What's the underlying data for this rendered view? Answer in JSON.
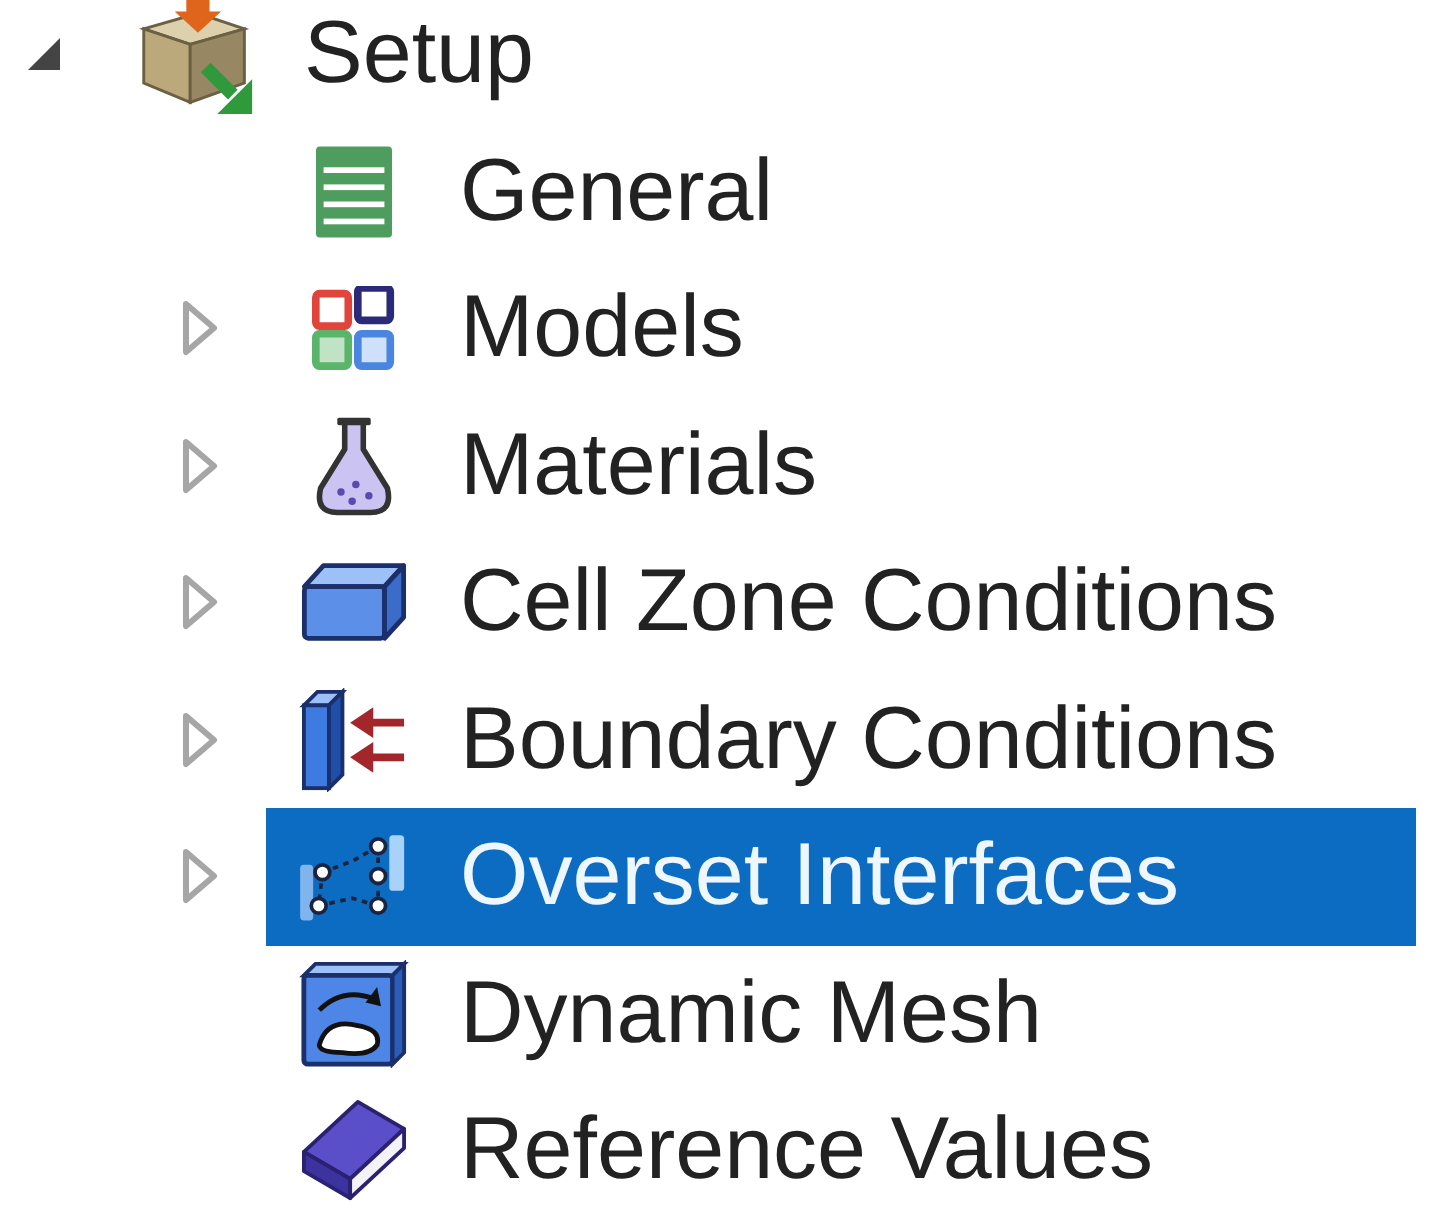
{
  "tree": [
    {
      "label": "Setup",
      "expanded": true,
      "selected": false,
      "children": [
        {
          "label": "General",
          "selected": false
        },
        {
          "label": "Models",
          "expanded": false,
          "selected": false
        },
        {
          "label": "Materials",
          "expanded": false,
          "selected": false
        },
        {
          "label": "Cell Zone Conditions",
          "expanded": false,
          "selected": false
        },
        {
          "label": "Boundary Conditions",
          "expanded": false,
          "selected": false
        },
        {
          "label": "Overset Interfaces",
          "expanded": false,
          "selected": true
        },
        {
          "label": "Dynamic Mesh",
          "selected": false
        },
        {
          "label": "Reference Values",
          "selected": false
        }
      ]
    }
  ]
}
